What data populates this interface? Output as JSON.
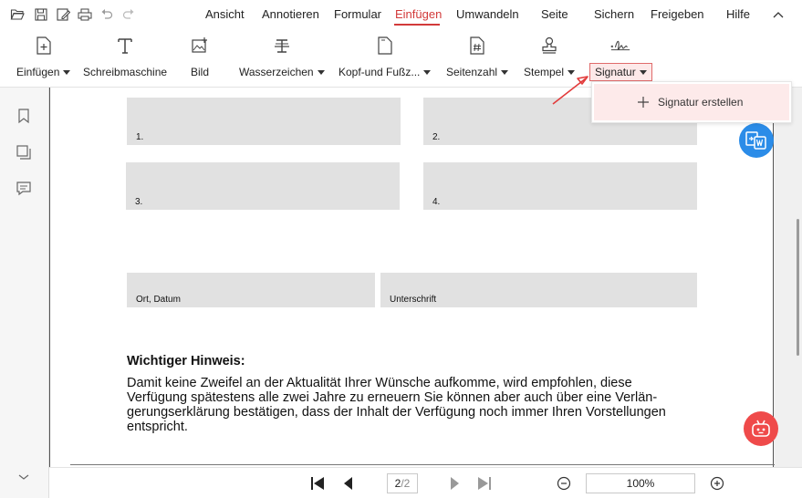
{
  "menu": {
    "items": [
      "Ansicht",
      "Annotieren",
      "Formular",
      "Einfügen",
      "Umwandeln",
      "Seite",
      "Sichern",
      "Freigeben",
      "Hilfe"
    ],
    "active": "Einfügen"
  },
  "ribbon": {
    "tools": [
      {
        "label": "Einfügen",
        "icon": "add-page-icon",
        "dropdown": true
      },
      {
        "label": "Schreibmaschine",
        "icon": "typewriter-icon",
        "dropdown": false
      },
      {
        "label": "Bild",
        "icon": "image-icon",
        "dropdown": false
      },
      {
        "label": "Wasserzeichen",
        "icon": "watermark-icon",
        "dropdown": true
      },
      {
        "label": "Kopf-und Fußz...",
        "icon": "header-footer-icon",
        "dropdown": true
      },
      {
        "label": "Seitenzahl",
        "icon": "page-number-icon",
        "dropdown": true
      },
      {
        "label": "Stempel",
        "icon": "stamp-icon",
        "dropdown": true
      },
      {
        "label": "Signatur",
        "icon": "signature-icon",
        "dropdown": true
      }
    ],
    "selected": "Signatur"
  },
  "dropdown": {
    "option": "Signatur erstellen"
  },
  "document": {
    "boxes": {
      "b1": "1.",
      "b2": "2.",
      "b3": "3.",
      "b4": "4.",
      "place_date": "Ort, Datum",
      "signature": "Unterschrift"
    },
    "notice_title": "Wichtiger Hinweis:",
    "notice_lines": [
      "Damit keine Zweifel an der Aktualität Ihrer Wünsche aufkomme, wird empfohlen, diese",
      "Verfügung spätestens alle zwei Jahre zu erneuern Sie können aber auch über eine Verlän-",
      "gerungserklärung bestätigen, dass der Inhalt der Verfügung noch immer Ihren Vorstellungen",
      "entspricht."
    ]
  },
  "pagination": {
    "current": "2",
    "total": "/2",
    "zoom": "100%"
  },
  "colors": {
    "accent": "#d23a3a",
    "selected_bg": "#fde9e9",
    "convert_button": "#2b8ce8",
    "ai_button": "#ef4a4a"
  }
}
